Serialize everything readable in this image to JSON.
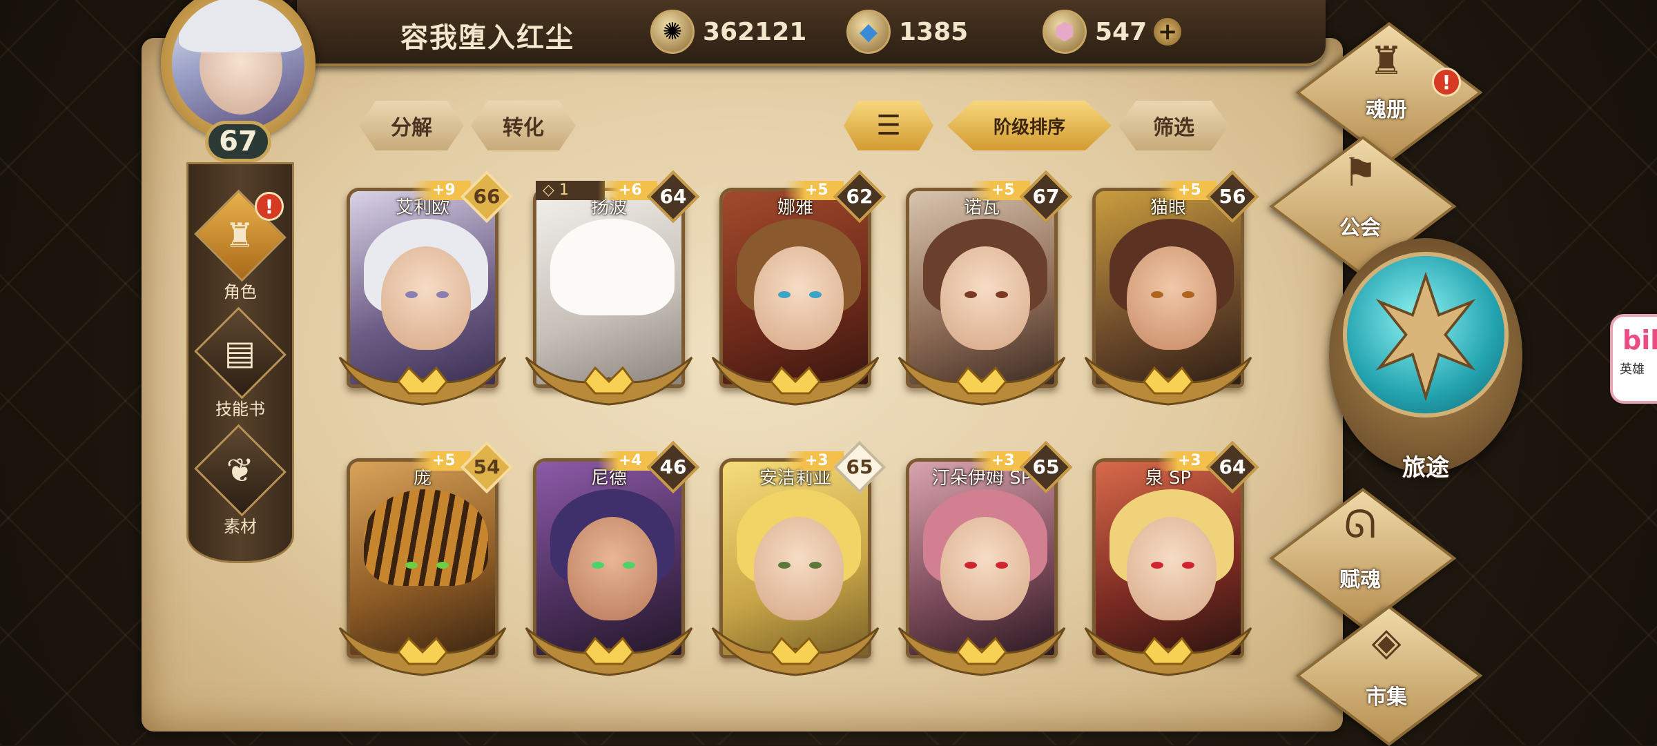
{
  "player": {
    "name": "容我堕入红尘",
    "level": "67"
  },
  "currencies": [
    {
      "name": "gold",
      "icon": "coin-icon",
      "value": "362121"
    },
    {
      "name": "crystal",
      "icon": "blue-crystal-icon",
      "value": "1385"
    },
    {
      "name": "gem",
      "icon": "pink-gem-icon",
      "value": "547"
    }
  ],
  "left_tabs": [
    {
      "label": "角色",
      "icon": "character-helmet-icon",
      "active": true,
      "alert": "!"
    },
    {
      "label": "技能书",
      "icon": "skill-book-icon",
      "active": false
    },
    {
      "label": "素材",
      "icon": "material-icon",
      "active": false
    }
  ],
  "actions": {
    "decompose": "分解",
    "convert": "转化",
    "sort_by_tier": "阶级排序",
    "filter": "筛选"
  },
  "heroes": [
    {
      "name": "艾利欧",
      "plus": "+9",
      "level": "66",
      "badge": "gold"
    },
    {
      "name": "扬波",
      "plus": "+6",
      "level": "64",
      "badge": "dark",
      "extra": "1"
    },
    {
      "name": "娜雅",
      "plus": "+5",
      "level": "62",
      "badge": "dark"
    },
    {
      "name": "诺瓦",
      "plus": "+5",
      "level": "67",
      "badge": "dark"
    },
    {
      "name": "猫眼",
      "plus": "+5",
      "level": "56",
      "badge": "dark"
    },
    {
      "name": "庞",
      "plus": "+5",
      "level": "54",
      "badge": "gold"
    },
    {
      "name": "尼德",
      "plus": "+4",
      "level": "46",
      "badge": "dark"
    },
    {
      "name": "安洁莉亚",
      "plus": "+3",
      "level": "65",
      "badge": "white"
    },
    {
      "name": "汀朵伊姆 SP",
      "plus": "+3",
      "level": "65",
      "badge": "dark"
    },
    {
      "name": "泉 SP",
      "plus": "+3",
      "level": "64",
      "badge": "dark"
    }
  ],
  "right_menu": {
    "soul_book": "魂册",
    "guild": "公会",
    "journey": "旅途",
    "soul_grant": "赋魂",
    "market": "市集",
    "alert": "!"
  },
  "side_badge": {
    "logo": "bili",
    "caption": "英雄"
  },
  "colors": {
    "accent_gold": "#f3c04b",
    "parchment": "#e8d4ae",
    "alert_red": "#d63a22",
    "journey_teal": "#23a3b0"
  }
}
